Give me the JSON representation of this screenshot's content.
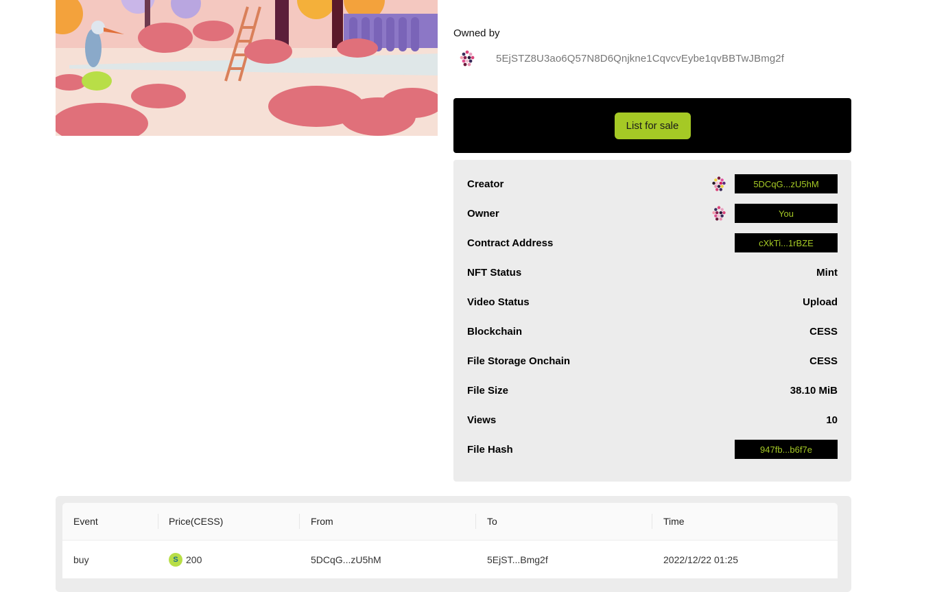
{
  "owned": {
    "label": "Owned by",
    "address": "5EjSTZ8U3ao6Q57N8D6Qnjkne1CqvcvEybe1qvBBTwJBmg2f"
  },
  "actions": {
    "list_for_sale": "List for sale"
  },
  "details": {
    "creator": {
      "label": "Creator",
      "value": "5DCqG...zU5hM"
    },
    "owner": {
      "label": "Owner",
      "value": "You"
    },
    "contract": {
      "label": "Contract Address",
      "value": "cXkTi...1rBZE"
    },
    "nft_status": {
      "label": "NFT Status",
      "value": "Mint"
    },
    "video_status": {
      "label": "Video Status",
      "value": "Upload"
    },
    "blockchain": {
      "label": "Blockchain",
      "value": "CESS"
    },
    "file_storage": {
      "label": "File Storage Onchain",
      "value": "CESS"
    },
    "file_size": {
      "label": "File Size",
      "value": "38.10 MiB"
    },
    "views": {
      "label": "Views",
      "value": "10"
    },
    "file_hash": {
      "label": "File Hash",
      "value": "947fb...b6f7e"
    }
  },
  "history": {
    "headers": {
      "event": "Event",
      "price": "Price(CESS)",
      "from": "From",
      "to": "To",
      "time": "Time"
    },
    "rows": [
      {
        "event": "buy",
        "price": "200",
        "from": "5DCqG...zU5hM",
        "to": "5EjST...Bmg2f",
        "time": "2022/12/22 01:25"
      }
    ]
  },
  "colors": {
    "accent": "#a5c925",
    "panel_bg": "#ececec",
    "chip_bg": "#000000"
  },
  "icons": {
    "avatar": "identicon-avatar",
    "coin": "cess-coin-icon"
  }
}
